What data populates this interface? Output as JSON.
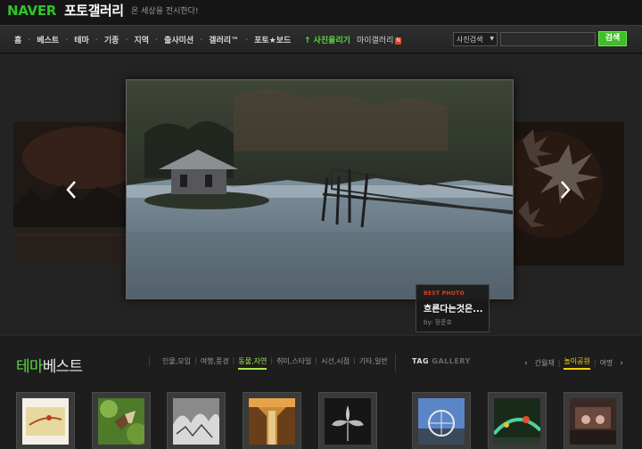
{
  "header": {
    "logo": "NAVER",
    "title": "포토갤러리",
    "tagline": "온 세상을 전시한다!"
  },
  "nav": {
    "items": [
      "홈",
      "베스트",
      "테마",
      "기종",
      "지역",
      "출사미션",
      "갤러리™",
      "포토★보드"
    ],
    "upload_label": "사진올리기",
    "my_gallery_label": "마이갤러리",
    "new_badge": "N",
    "search_select": "사진검색",
    "search_value": "",
    "search_button": "검색"
  },
  "carousel": {
    "caption_label": "BEST PHOTO",
    "caption_title": "흐른다는것은...",
    "caption_author": "by: 정준호"
  },
  "theme": {
    "title_accent": "테마",
    "title_rest": "베스트",
    "tabs": [
      "인물,모임",
      "여행,풍경",
      "동물,자연",
      "취미,스타일",
      "시선,시점",
      "기타,일반"
    ],
    "active_tab": "동물,자연"
  },
  "tag_gallery": {
    "title_main": "TAG",
    "title_dim": "GALLERY",
    "tabs": [
      "간월재",
      "놀이공원",
      "여명"
    ],
    "active_tab": "놀이공원"
  },
  "colors": {
    "accent_green": "#5dd83f",
    "badge_red": "#e0431f",
    "tag_active": "#ffd200"
  }
}
